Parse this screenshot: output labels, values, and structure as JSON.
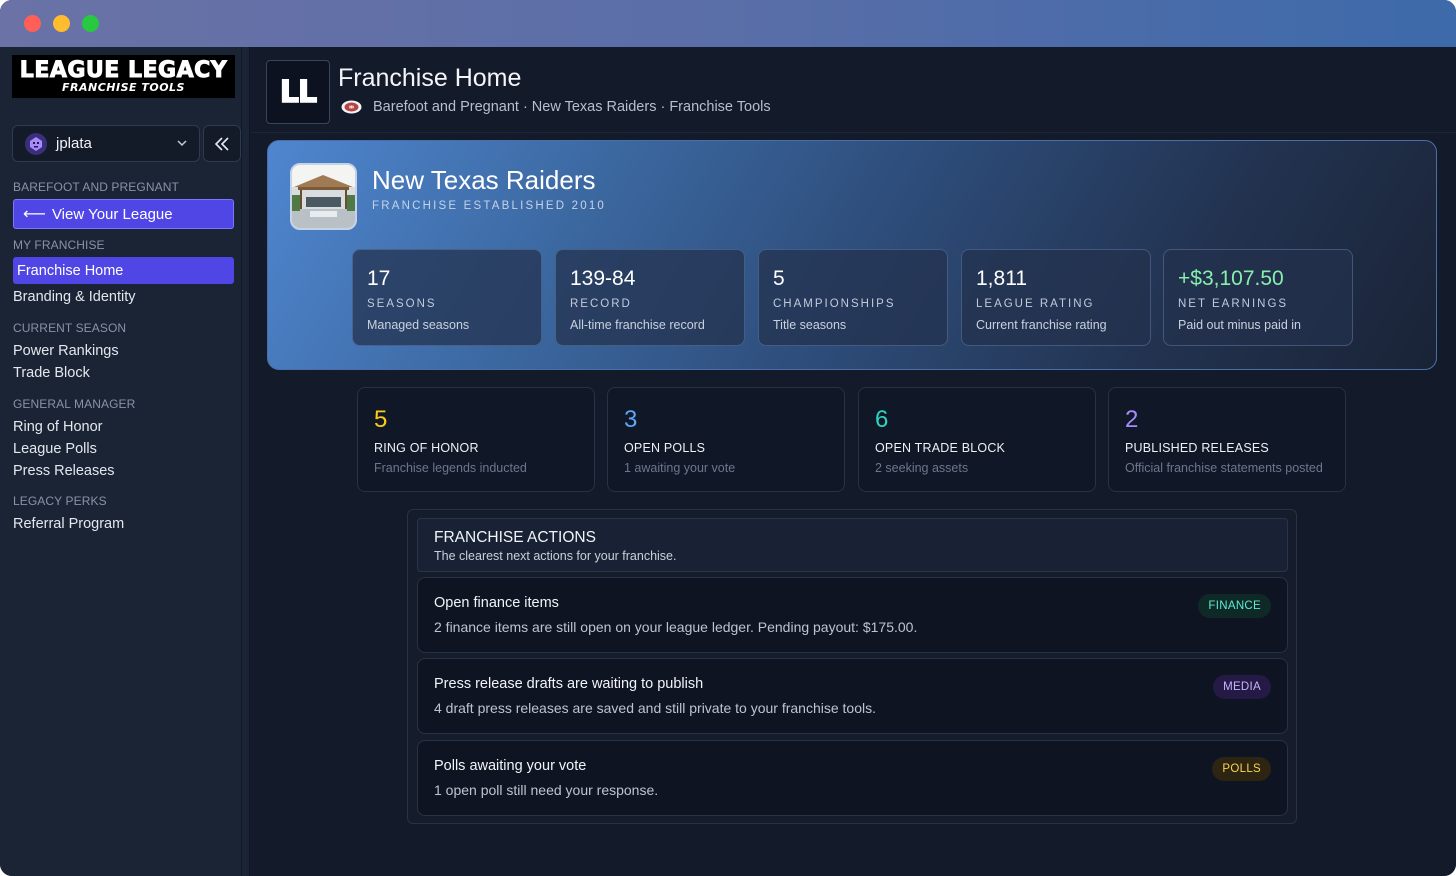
{
  "sidebar": {
    "logo_main": "LEAGUE LEGACY",
    "logo_sub": "FRANCHISE TOOLS",
    "user": "jplata",
    "sections": {
      "league_label": "BAREFOOT AND PREGNANT",
      "view_league": "View Your League",
      "my_franchise": "MY FRANCHISE",
      "franchise_home": "Franchise Home",
      "branding": "Branding & Identity",
      "current_season": "CURRENT SEASON",
      "power_rankings": "Power Rankings",
      "trade_block": "Trade Block",
      "general_manager": "GENERAL MANAGER",
      "ring_of_honor": "Ring of Honor",
      "league_polls": "League Polls",
      "press_releases": "Press Releases",
      "legacy_perks": "LEGACY PERKS",
      "referral_program": "Referral Program"
    }
  },
  "header": {
    "logo_text": "LL",
    "title": "Franchise Home",
    "breadcrumb": "Barefoot and Pregnant · New Texas Raiders · Franchise Tools"
  },
  "hero": {
    "team_name": "New Texas Raiders",
    "established": "FRANCHISE ESTABLISHED 2010",
    "stats": [
      {
        "value": "17",
        "label": "SEASONS",
        "sub": "Managed seasons"
      },
      {
        "value": "139-84",
        "label": "RECORD",
        "sub": "All-time franchise record"
      },
      {
        "value": "5",
        "label": "CHAMPIONSHIPS",
        "sub": "Title seasons"
      },
      {
        "value": "1,811",
        "label": "LEAGUE RATING",
        "sub": "Current franchise rating"
      },
      {
        "value": "+$3,107.50",
        "label": "NET EARNINGS",
        "sub": "Paid out minus paid in"
      }
    ]
  },
  "kpis": [
    {
      "value": "5",
      "label": "RING OF HONOR",
      "sub": "Franchise legends inducted",
      "color": "#facc15"
    },
    {
      "value": "3",
      "label": "OPEN POLLS",
      "sub": "1 awaiting your vote",
      "color": "#60a5fa"
    },
    {
      "value": "6",
      "label": "OPEN TRADE BLOCK",
      "sub": "2 seeking assets",
      "color": "#2dd4bf"
    },
    {
      "value": "2",
      "label": "PUBLISHED RELEASES",
      "sub": "Official franchise statements posted",
      "color": "#a78bfa"
    }
  ],
  "actions": {
    "title": "FRANCHISE ACTIONS",
    "subtitle": "The clearest next actions for your franchise.",
    "items": [
      {
        "title": "Open finance items",
        "desc": "2 finance items are still open on your league ledger. Pending payout: $175.00.",
        "tag": "FINANCE"
      },
      {
        "title": "Press release drafts are waiting to publish",
        "desc": "4 draft press releases are saved and still private to your franchise tools.",
        "tag": "MEDIA"
      },
      {
        "title": "Polls awaiting your vote",
        "desc": "1 open poll still need your response.",
        "tag": "POLLS"
      }
    ]
  },
  "colors": {
    "accent": "#4f46e5",
    "net_earnings": "#86efac"
  }
}
